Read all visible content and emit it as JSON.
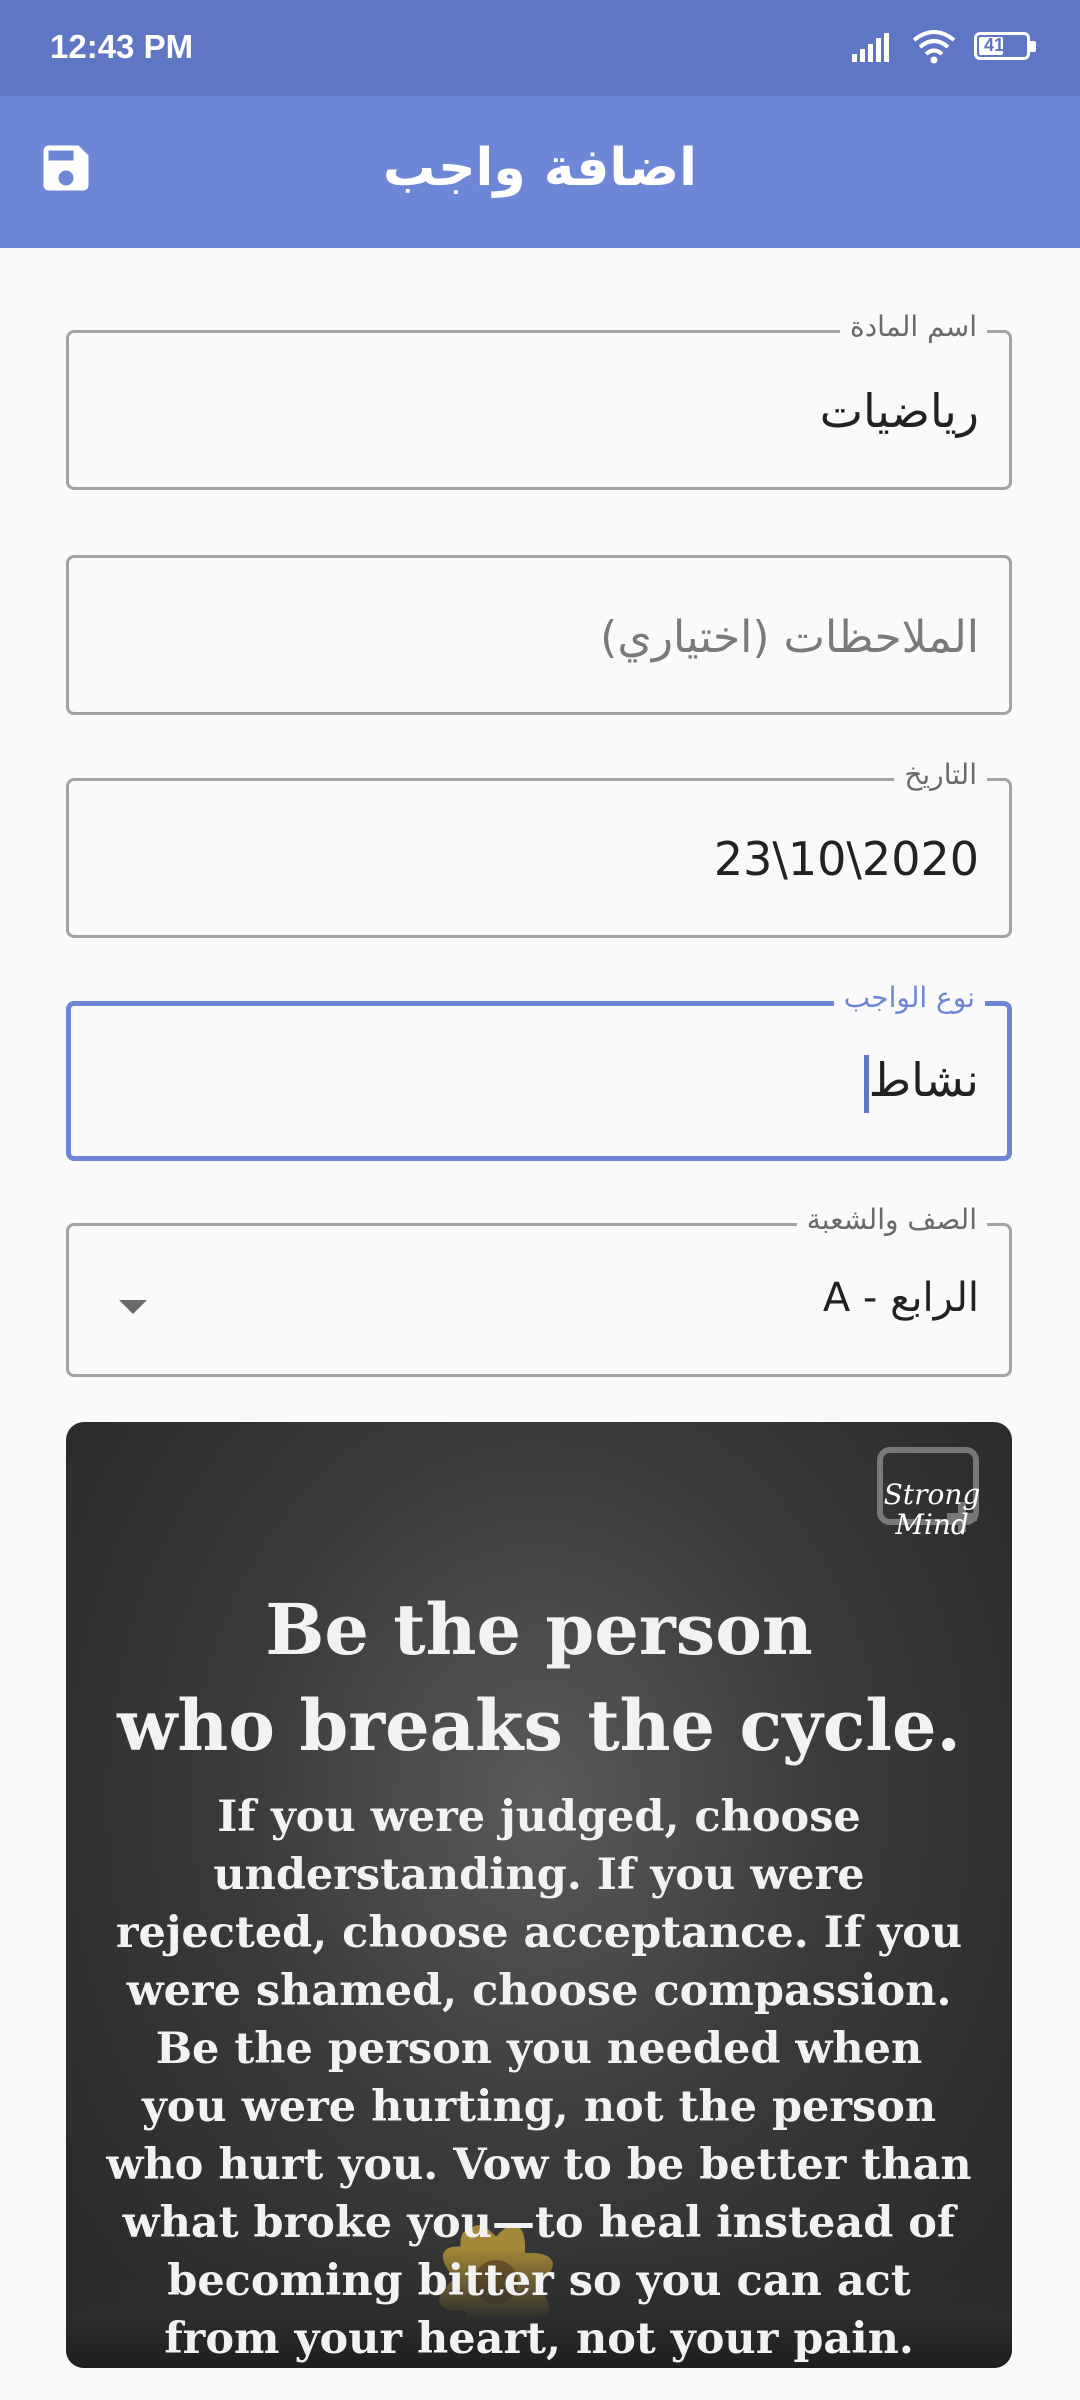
{
  "status_bar": {
    "time": "12:43 PM",
    "battery": "41"
  },
  "app_bar": {
    "title": "اضافة واجب",
    "save_icon": "save-icon"
  },
  "form": {
    "subject": {
      "label": "اسم المادة",
      "value": "رياضيات"
    },
    "notes": {
      "placeholder": "الملاحظات (اختياري)"
    },
    "date": {
      "label": "التاريخ",
      "value": "23\\10\\2020"
    },
    "homework_type": {
      "label": "نوع الواجب",
      "value": "نشاط"
    },
    "class_section": {
      "label": "الصف والشعبة",
      "value": "الرابع - A"
    }
  },
  "image": {
    "headline_line1": "Be the person",
    "headline_line2": "who breaks the cycle.",
    "body": "If you were judged, choose understanding. If you were rejected, choose acceptance. If you were shamed, choose compassion. Be the person you needed when you were hurting, not the person who hurt you. Vow to be better than what broke you—to heal instead of becoming bitter so you can act from your heart, not your pain.",
    "brand_line1": "Strong",
    "brand_line2": "Mind"
  },
  "colors": {
    "status_bar": "#5f76c4",
    "app_bar": "#6e86d6",
    "accent": "#6e86d6",
    "border": "#a3a3a3"
  }
}
